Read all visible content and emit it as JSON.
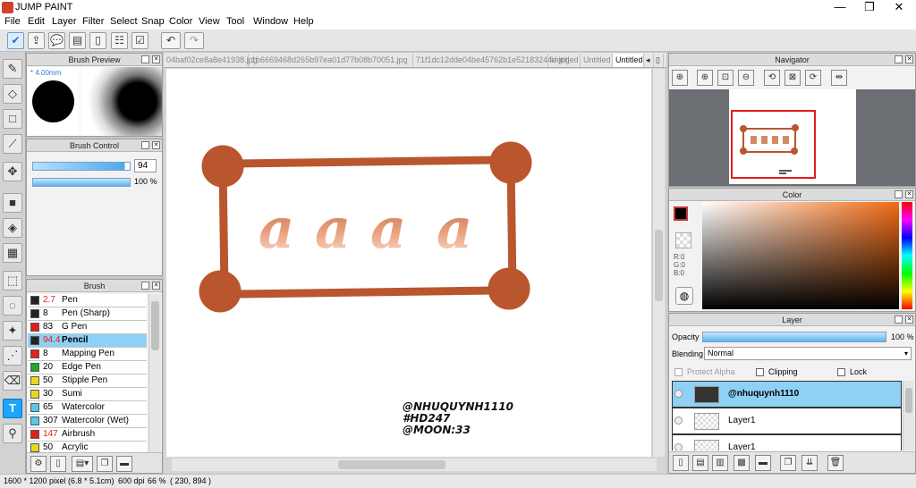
{
  "app": {
    "title": "JUMP PAINT"
  },
  "window_controls": {
    "minimize": "—",
    "maximize": "❐",
    "close": "✕"
  },
  "menu": [
    {
      "label": "File"
    },
    {
      "label": "Edit"
    },
    {
      "label": "Layer"
    },
    {
      "label": "Filter"
    },
    {
      "label": "Select"
    },
    {
      "label": "Snap"
    },
    {
      "label": "Color"
    },
    {
      "label": "View"
    },
    {
      "label": "Tool"
    },
    {
      "label": "Window"
    },
    {
      "label": "Help"
    }
  ],
  "brush_preview": {
    "title": "Brush Preview",
    "size": "4.00mm"
  },
  "brush_control": {
    "title": "Brush Control",
    "size_value": "94",
    "opacity_value": "100 %"
  },
  "brush_list": {
    "title": "Brush",
    "items": [
      {
        "size": "2.7",
        "name": "Pen",
        "color": "#222222",
        "size_red": true
      },
      {
        "size": "8",
        "name": "Pen (Sharp)",
        "color": "#222222",
        "size_red": false
      },
      {
        "size": "83",
        "name": "G Pen",
        "color": "#e02020",
        "size_red": false
      },
      {
        "size": "94.4",
        "name": "Pencil",
        "color": "#222222",
        "size_red": true,
        "selected": true
      },
      {
        "size": "8",
        "name": "Mapping Pen",
        "color": "#e02020",
        "size_red": false
      },
      {
        "size": "20",
        "name": "Edge Pen",
        "color": "#22aa22",
        "size_red": false
      },
      {
        "size": "50",
        "name": "Stipple Pen",
        "color": "#e8d820",
        "size_red": false
      },
      {
        "size": "30",
        "name": "Sumi",
        "color": "#e8d820",
        "size_red": false
      },
      {
        "size": "65",
        "name": "Watercolor",
        "color": "#58c8e8",
        "size_red": false
      },
      {
        "size": "307",
        "name": "Watercolor (Wet)",
        "color": "#58c8e8",
        "size_red": false
      },
      {
        "size": "147",
        "name": "Airbrush",
        "color": "#e02020",
        "size_red": true
      },
      {
        "size": "50",
        "name": "Acrylic",
        "color": "#e8d820",
        "size_red": false
      }
    ]
  },
  "tabs": [
    {
      "label": "04baf02ce8a8e41938.jpg",
      "active": false
    },
    {
      "label": "1b6669468d265b97ea01d77b08b70051.jpg",
      "active": false
    },
    {
      "label": "71f1dc12dde04be45762b1e52183244e.jpg",
      "active": false
    },
    {
      "label": "Untitled",
      "active": false
    },
    {
      "label": "Untitled",
      "active": false
    },
    {
      "label": "Untitled",
      "active": true
    }
  ],
  "canvas": {
    "frame_color": "#b9562e",
    "letters": "aaaa",
    "watermark_lines": [
      "@NHUQUYNH1110",
      "#HD247",
      "@MOON:33"
    ]
  },
  "navigator": {
    "title": "Navigator"
  },
  "color_panel": {
    "title": "Color",
    "r": "R:0",
    "g": "G:0",
    "b": "B:0",
    "current": "#000000"
  },
  "layer_panel": {
    "title": "Layer",
    "opacity_label": "Opacity",
    "opacity_value": "100 %",
    "blending_label": "Blending",
    "blending_value": "Normal",
    "protect_alpha": "Protect Alpha",
    "clipping": "Clipping",
    "lock": "Lock",
    "layers": [
      {
        "name": "@nhuquynh1110",
        "selected": true
      },
      {
        "name": "Layer1",
        "selected": false
      },
      {
        "name": "Layer1",
        "selected": false
      }
    ]
  },
  "status": {
    "size": "1600 * 1200 pixel",
    "phys": "(6.8 * 5.1cm)",
    "dpi": "600 dpi",
    "zoom": "66 %",
    "cursor": "( 230, 894 )"
  }
}
